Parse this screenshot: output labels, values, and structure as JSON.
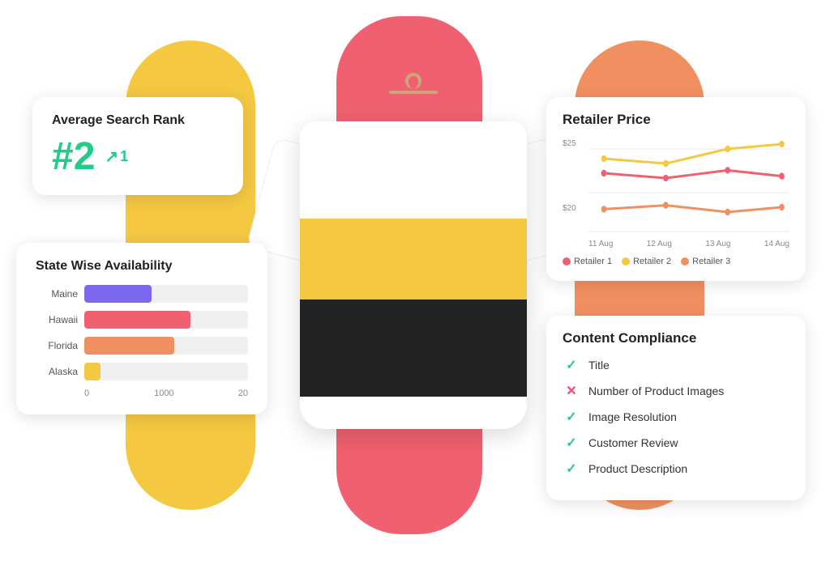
{
  "scene": {
    "background": "white"
  },
  "rank_card": {
    "title": "Average Search Rank",
    "rank": "#2",
    "change": "1",
    "change_direction": "up"
  },
  "availability_card": {
    "title": "State Wise Availability",
    "bars": [
      {
        "label": "Maine",
        "value": 820,
        "max": 2000,
        "color": "#7B68EE"
      },
      {
        "label": "Hawaii",
        "value": 1300,
        "max": 2000,
        "color": "#f06070"
      },
      {
        "label": "Florida",
        "value": 1100,
        "max": 2000,
        "color": "#f09060"
      },
      {
        "label": "Alaska",
        "value": 200,
        "max": 2000,
        "color": "#f5c842"
      }
    ],
    "axis_start": "0",
    "axis_mid": "1000",
    "axis_end": "20"
  },
  "price_card": {
    "title": "Retailer Price",
    "y_high": "$25",
    "y_low": "$20",
    "x_labels": [
      "11 Aug",
      "12 Aug",
      "13 Aug",
      "14 Aug"
    ],
    "legend": [
      {
        "label": "Retailer 1",
        "color": "#f06070"
      },
      {
        "label": "Retailer 2",
        "color": "#f5c842"
      },
      {
        "label": "Retailer 3",
        "color": "#f09060"
      }
    ],
    "series": {
      "retailer1": {
        "color": "#f06070",
        "points": [
          23,
          22.5,
          23.5,
          22.8
        ]
      },
      "retailer2": {
        "color": "#f5c842",
        "points": [
          24,
          23.8,
          24.5,
          25
        ]
      },
      "retailer3": {
        "color": "#f09060",
        "points": [
          21,
          21.5,
          21.2,
          21.8
        ]
      }
    }
  },
  "compliance_card": {
    "title": "Content Compliance",
    "items": [
      {
        "label": "Title",
        "status": "check"
      },
      {
        "label": "Number of Product Images",
        "status": "cross"
      },
      {
        "label": "Image Resolution",
        "status": "check"
      },
      {
        "label": "Customer Review",
        "status": "check"
      },
      {
        "label": "Product Description",
        "status": "check"
      }
    ]
  },
  "hanger": {
    "label": "clothing-hanger"
  }
}
